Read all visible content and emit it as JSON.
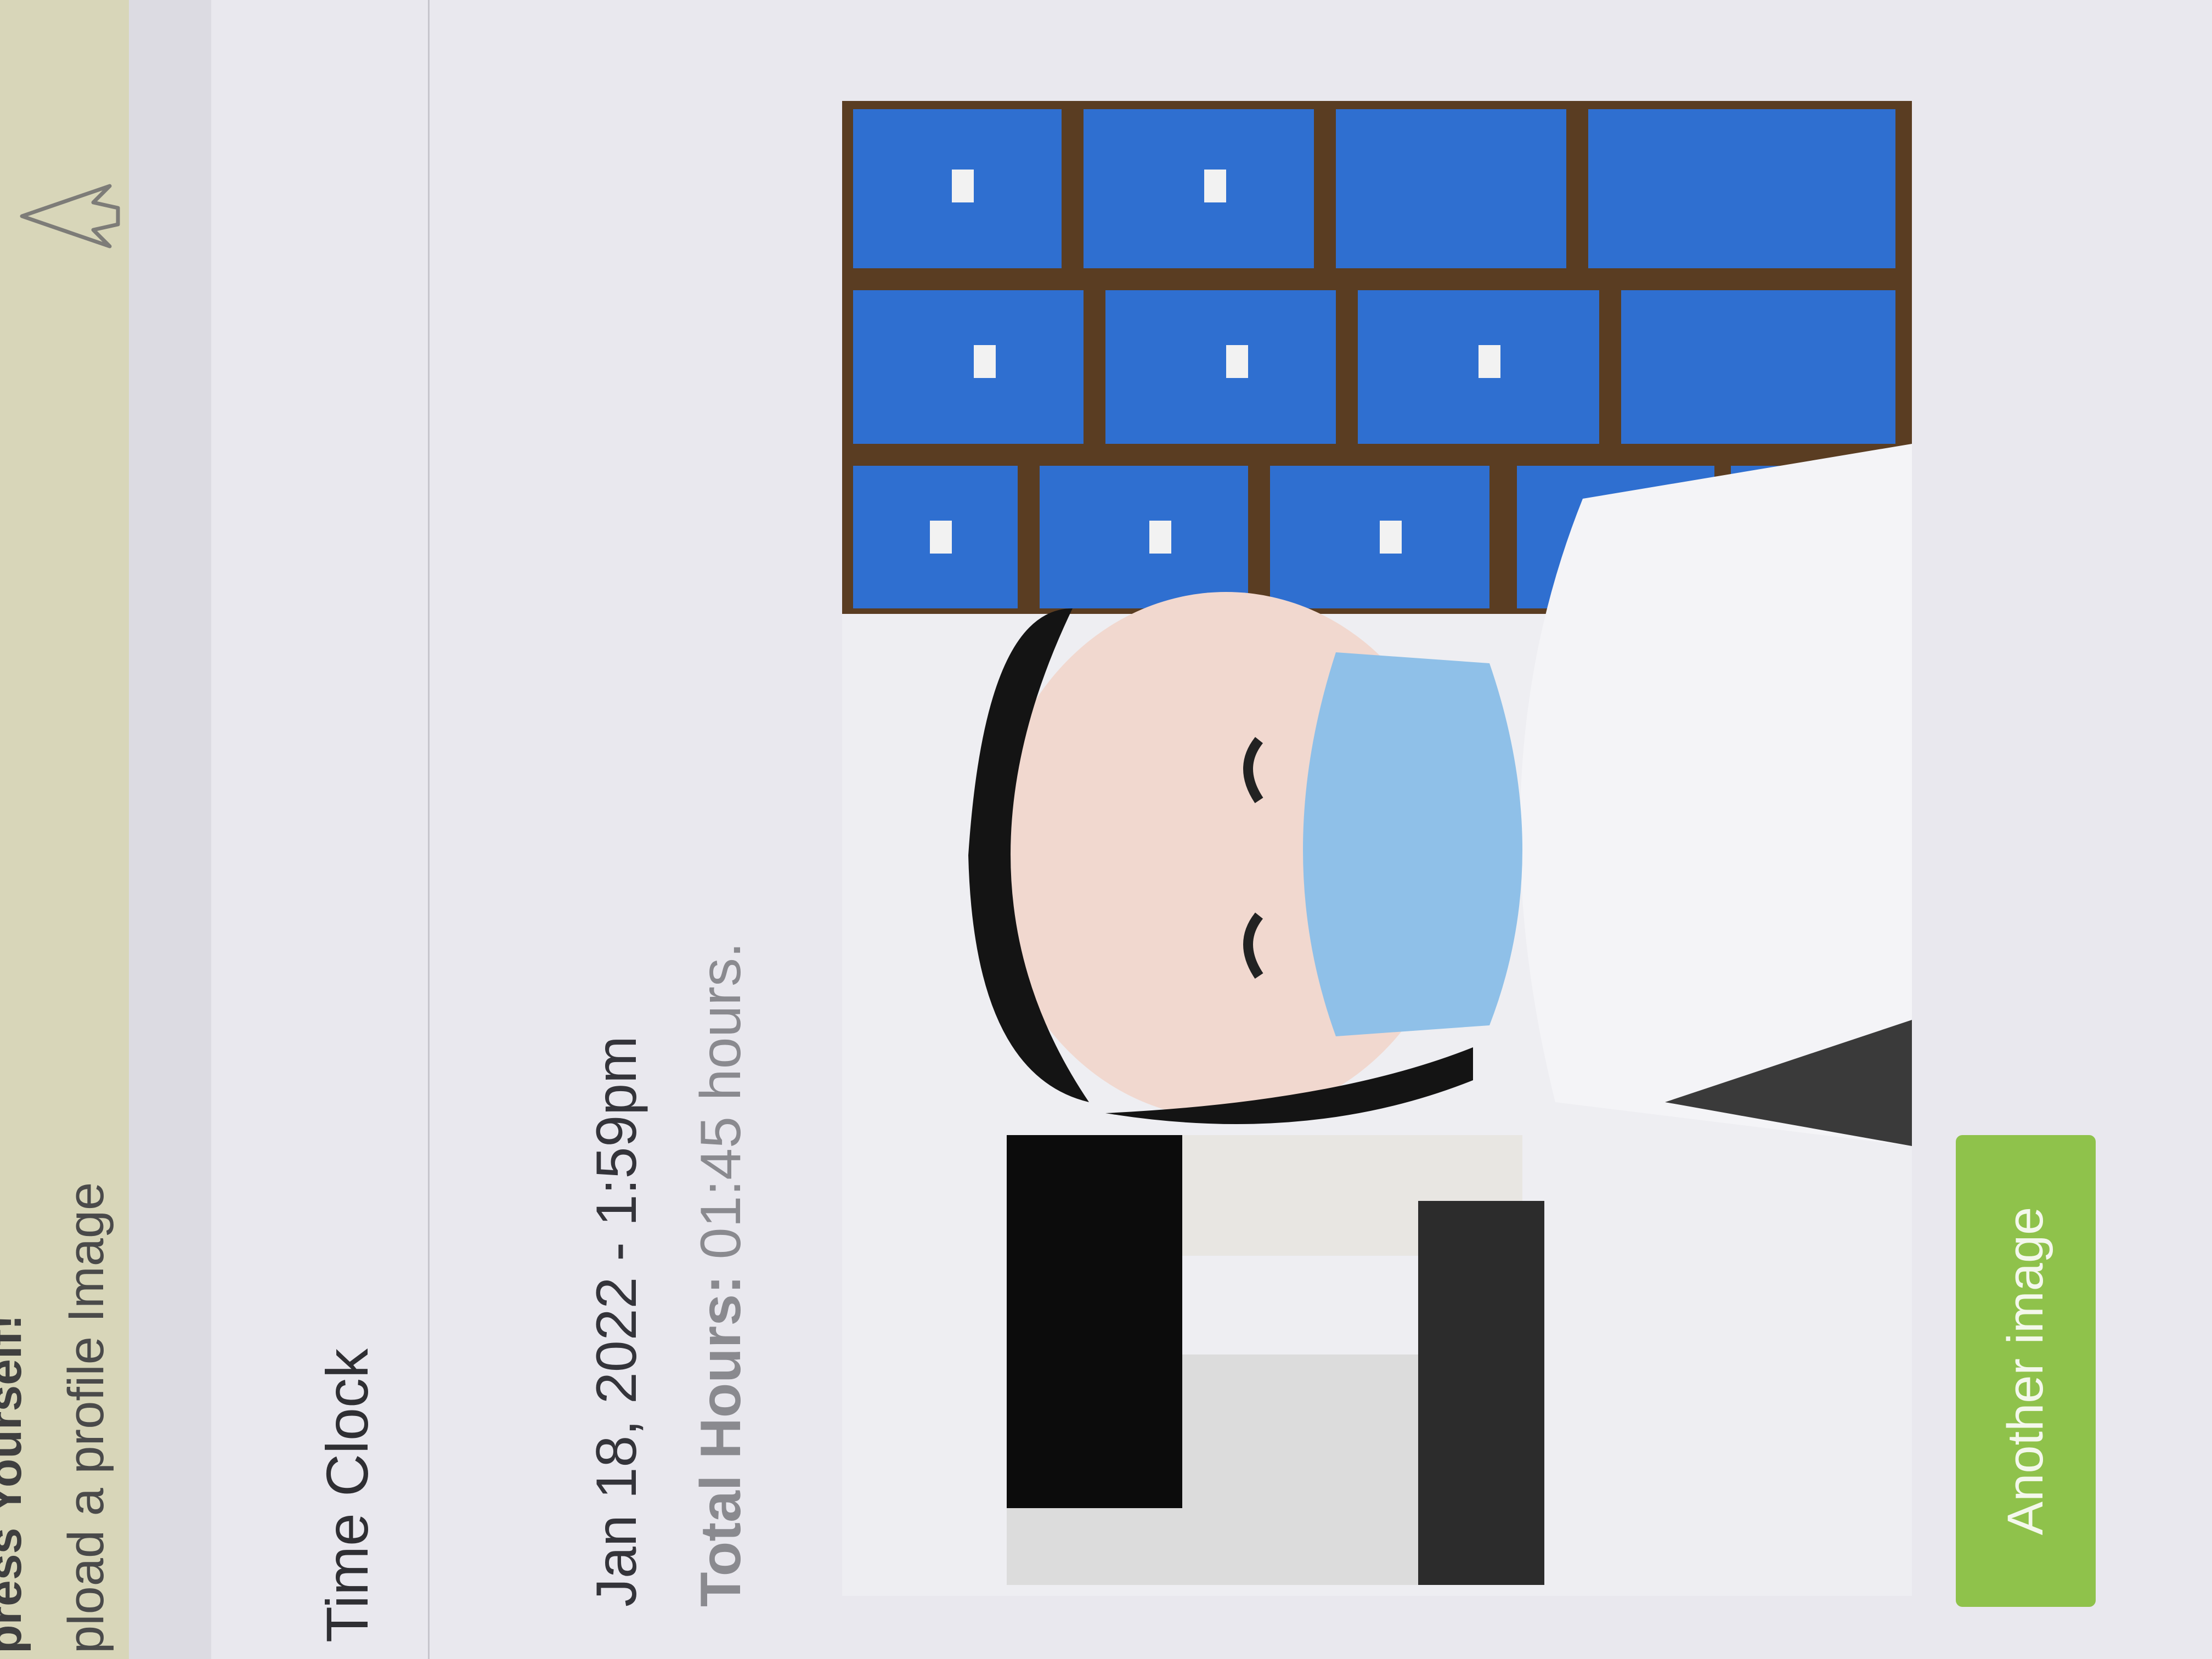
{
  "header": {
    "title": "press Yourself!",
    "subtitle": "pload a profile Image",
    "icon": "pointer-cursor-icon"
  },
  "time_clock": {
    "title": "Time Clock",
    "entry": {
      "date_time": "Jan 18, 2022 - 1:59pm",
      "total_hours_label": "Total Hours:",
      "total_hours_value": "01:45 hours."
    },
    "photo_alt": "Clock-in selfie photo",
    "another_image_label": "Another image"
  },
  "colors": {
    "button_green": "#8fc24b",
    "banner": "#d8d6b9",
    "page_bg": "#e9e8ee"
  }
}
